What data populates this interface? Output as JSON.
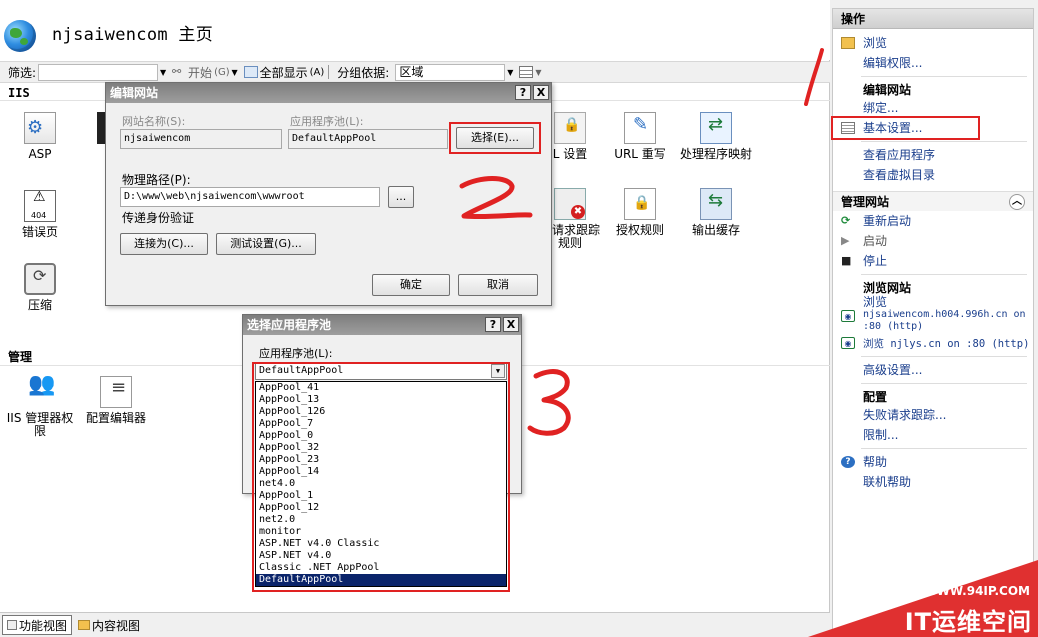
{
  "header": {
    "title": "njsaiwencom 主页"
  },
  "toolbar": {
    "filter_label": "筛选:",
    "start_label": "开始",
    "start_key": "(G)",
    "show_all_label": "全部显示",
    "show_all_key": "(A)",
    "group_by_label": "分组依据:",
    "group_by_value": "区域"
  },
  "sections": {
    "iis": "IIS",
    "management": "管理"
  },
  "features": {
    "asp": "ASP",
    "error_pages": "错误页",
    "compression": "压缩",
    "ssl": "L 设置",
    "url_rewrite": "URL 重写",
    "handler_mappings": "处理程序映射",
    "failed_request": "败请求跟踪规则",
    "authz_rules": "授权规则",
    "output_cache": "输出缓存",
    "iis_manager_perms": "IIS 管理器权限",
    "config_editor": "配置编辑器"
  },
  "bottom_tabs": {
    "features_view": "功能视图",
    "content_view": "内容视图"
  },
  "actions": {
    "header": "操作",
    "browse": "浏览",
    "edit_permissions": "编辑权限...",
    "edit_site_group": "编辑网站",
    "bindings": "绑定...",
    "basic_settings": "基本设置...",
    "view_app": "查看应用程序",
    "view_vdir": "查看虚拟目录",
    "manage_site_header": "管理网站",
    "restart": "重新启动",
    "start": "启动",
    "stop": "停止",
    "browse_site_group": "浏览网站",
    "browse_label": "浏览",
    "browse_url1_host": "njsaiwencom.h004.996h.cn on",
    "browse_url1_port": ":80 (http)",
    "browse_url2": "浏览 njlys.cn on :80 (http)",
    "advanced": "高级设置...",
    "config_group": "配置",
    "failed_tracing": "失败请求跟踪...",
    "limits": "限制...",
    "help": "帮助",
    "online_help": "联机帮助"
  },
  "edit_dialog": {
    "title": "编辑网站",
    "site_name_label": "网站名称(S):",
    "site_name_value": "njsaiwencom",
    "app_pool_label": "应用程序池(L):",
    "app_pool_value": "DefaultAppPool",
    "select_button": "选择(E)...",
    "physical_path_label": "物理路径(P):",
    "physical_path_value": "D:\\www\\web\\njsaiwencom\\wwwroot",
    "browse_button": "...",
    "passthrough_label": "传递身份验证",
    "connect_as_button": "连接为(C)...",
    "test_settings_button": "测试设置(G)...",
    "ok_button": "确定",
    "cancel_button": "取消",
    "help_btn": "?",
    "close_btn": "X"
  },
  "pool_dialog": {
    "title": "选择应用程序池",
    "label": "应用程序池(L):",
    "selected": "DefaultAppPool",
    "items": [
      "AppPool_41",
      "AppPool_13",
      "AppPool_126",
      "AppPool_7",
      "AppPool_0",
      "AppPool_32",
      "AppPool_23",
      "AppPool_14",
      "net4.0",
      "AppPool_1",
      "AppPool_12",
      "net2.0",
      "monitor",
      "ASP.NET v4.0 Classic",
      "ASP.NET v4.0",
      "Classic .NET AppPool",
      "DefaultAppPool"
    ],
    "help_btn": "?",
    "close_btn": "X"
  },
  "annotations": {
    "one": "1",
    "two": "2",
    "three": "3",
    "color": "#e02222"
  },
  "watermark": {
    "url": "WWW.94IP.COM",
    "text": "IT运维空间"
  }
}
